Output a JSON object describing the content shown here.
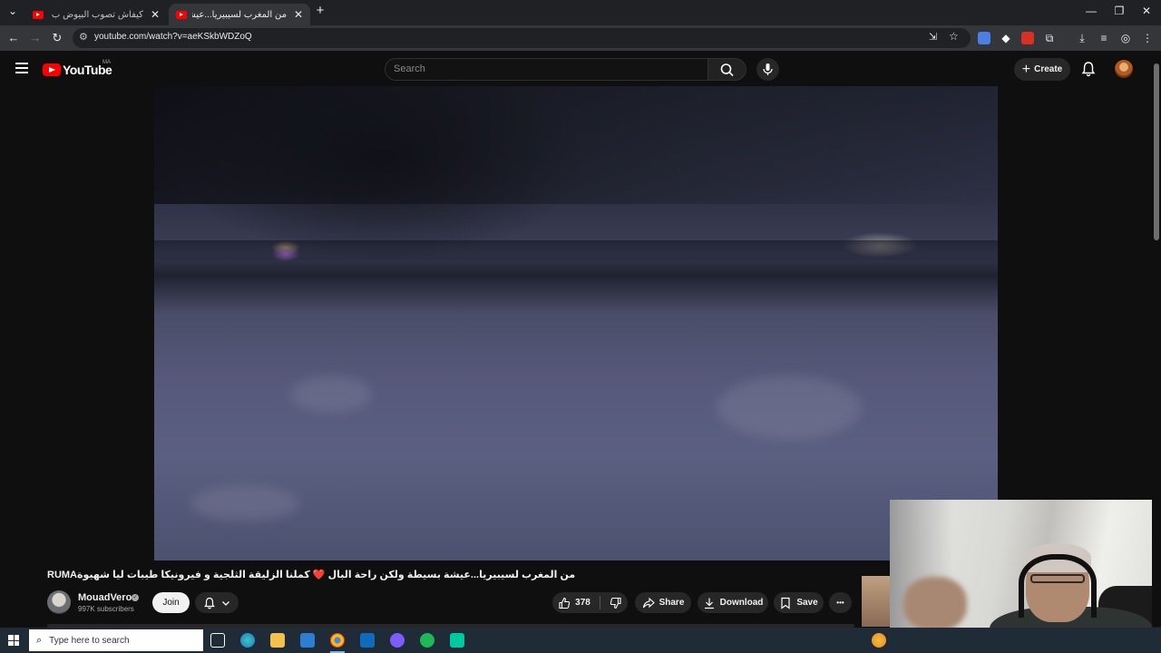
{
  "browser": {
    "tabs": [
      {
        "title": "كيفاش تصوب البيوض ب الاعشاب",
        "close": "✕",
        "active": false
      },
      {
        "title": "من المغرب لسيبيريا...عيشة ب",
        "close": "✕",
        "active": true
      }
    ],
    "new_tab": "+",
    "url": "youtube.com/watch?v=aeKSkbWDZoQ",
    "window_controls": {
      "minimize": "—",
      "restore": "❐",
      "close": "✕"
    }
  },
  "youtube": {
    "logo_text": "YouTube",
    "country_code": "MA",
    "search_placeholder": "Search",
    "create_label": "Create",
    "create_plus": "+"
  },
  "video": {
    "title": "RUMAمن المغرب لسيبيريا...عيشة بسيطة ولكن راحة البال ❤️ كملنا الزليقة الثلجية و فيرونيكا طيبات ليا شهيوة",
    "channel": "MouadVero",
    "verified_mark": "✓",
    "subscribers": "997K subscribers",
    "join_label": "Join",
    "likes": "378",
    "share_label": "Share",
    "download_label": "Download",
    "save_label": "Save",
    "more_label": "•••"
  },
  "taskbar": {
    "search_placeholder": "Type here to search"
  },
  "colors": {
    "yt_red": "#ff0000",
    "bg": "#0f0f0f",
    "pill": "#272727"
  }
}
